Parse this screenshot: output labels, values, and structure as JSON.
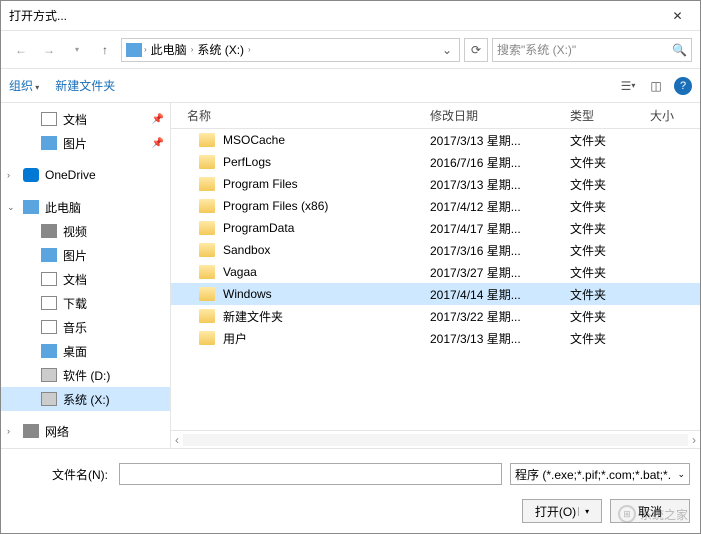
{
  "window": {
    "title": "打开方式..."
  },
  "nav": {
    "breadcrumb": [
      "此电脑",
      "系统 (X:)"
    ],
    "search_placeholder": "搜索\"系统 (X:)\""
  },
  "toolbar": {
    "organize": "组织",
    "newfolder": "新建文件夹"
  },
  "sidebar": {
    "quick": [
      {
        "label": "文档",
        "icon": "ic-doc",
        "pinned": true
      },
      {
        "label": "图片",
        "icon": "ic-pic",
        "pinned": true
      }
    ],
    "onedrive": {
      "label": "OneDrive",
      "icon": "ic-cloud"
    },
    "thispc": {
      "label": "此电脑",
      "icon": "ic-pc",
      "children": [
        {
          "label": "视频",
          "icon": "ic-vid"
        },
        {
          "label": "图片",
          "icon": "ic-pic"
        },
        {
          "label": "文档",
          "icon": "ic-doc"
        },
        {
          "label": "下载",
          "icon": "ic-dl"
        },
        {
          "label": "音乐",
          "icon": "ic-music"
        },
        {
          "label": "桌面",
          "icon": "ic-desk"
        },
        {
          "label": "软件 (D:)",
          "icon": "ic-drive"
        },
        {
          "label": "系统 (X:)",
          "icon": "ic-drive",
          "selected": true
        }
      ]
    },
    "network": {
      "label": "网络",
      "icon": "ic-net"
    }
  },
  "columns": {
    "name": "名称",
    "date": "修改日期",
    "type": "类型",
    "size": "大小"
  },
  "files": [
    {
      "name": "MSOCache",
      "date": "2017/3/13 星期...",
      "type": "文件夹"
    },
    {
      "name": "PerfLogs",
      "date": "2016/7/16 星期...",
      "type": "文件夹"
    },
    {
      "name": "Program Files",
      "date": "2017/3/13 星期...",
      "type": "文件夹"
    },
    {
      "name": "Program Files (x86)",
      "date": "2017/4/12 星期...",
      "type": "文件夹"
    },
    {
      "name": "ProgramData",
      "date": "2017/4/17 星期...",
      "type": "文件夹"
    },
    {
      "name": "Sandbox",
      "date": "2017/3/16 星期...",
      "type": "文件夹"
    },
    {
      "name": "Vagaa",
      "date": "2017/3/27 星期...",
      "type": "文件夹"
    },
    {
      "name": "Windows",
      "date": "2017/4/14 星期...",
      "type": "文件夹",
      "selected": true
    },
    {
      "name": "新建文件夹",
      "date": "2017/3/22 星期...",
      "type": "文件夹"
    },
    {
      "name": "用户",
      "date": "2017/3/13 星期...",
      "type": "文件夹"
    }
  ],
  "bottom": {
    "filename_label": "文件名(N):",
    "filter": "程序 (*.exe;*.pif;*.com;*.bat;*.",
    "open": "打开(O)",
    "cancel": "取消"
  },
  "watermark": "系统之家"
}
